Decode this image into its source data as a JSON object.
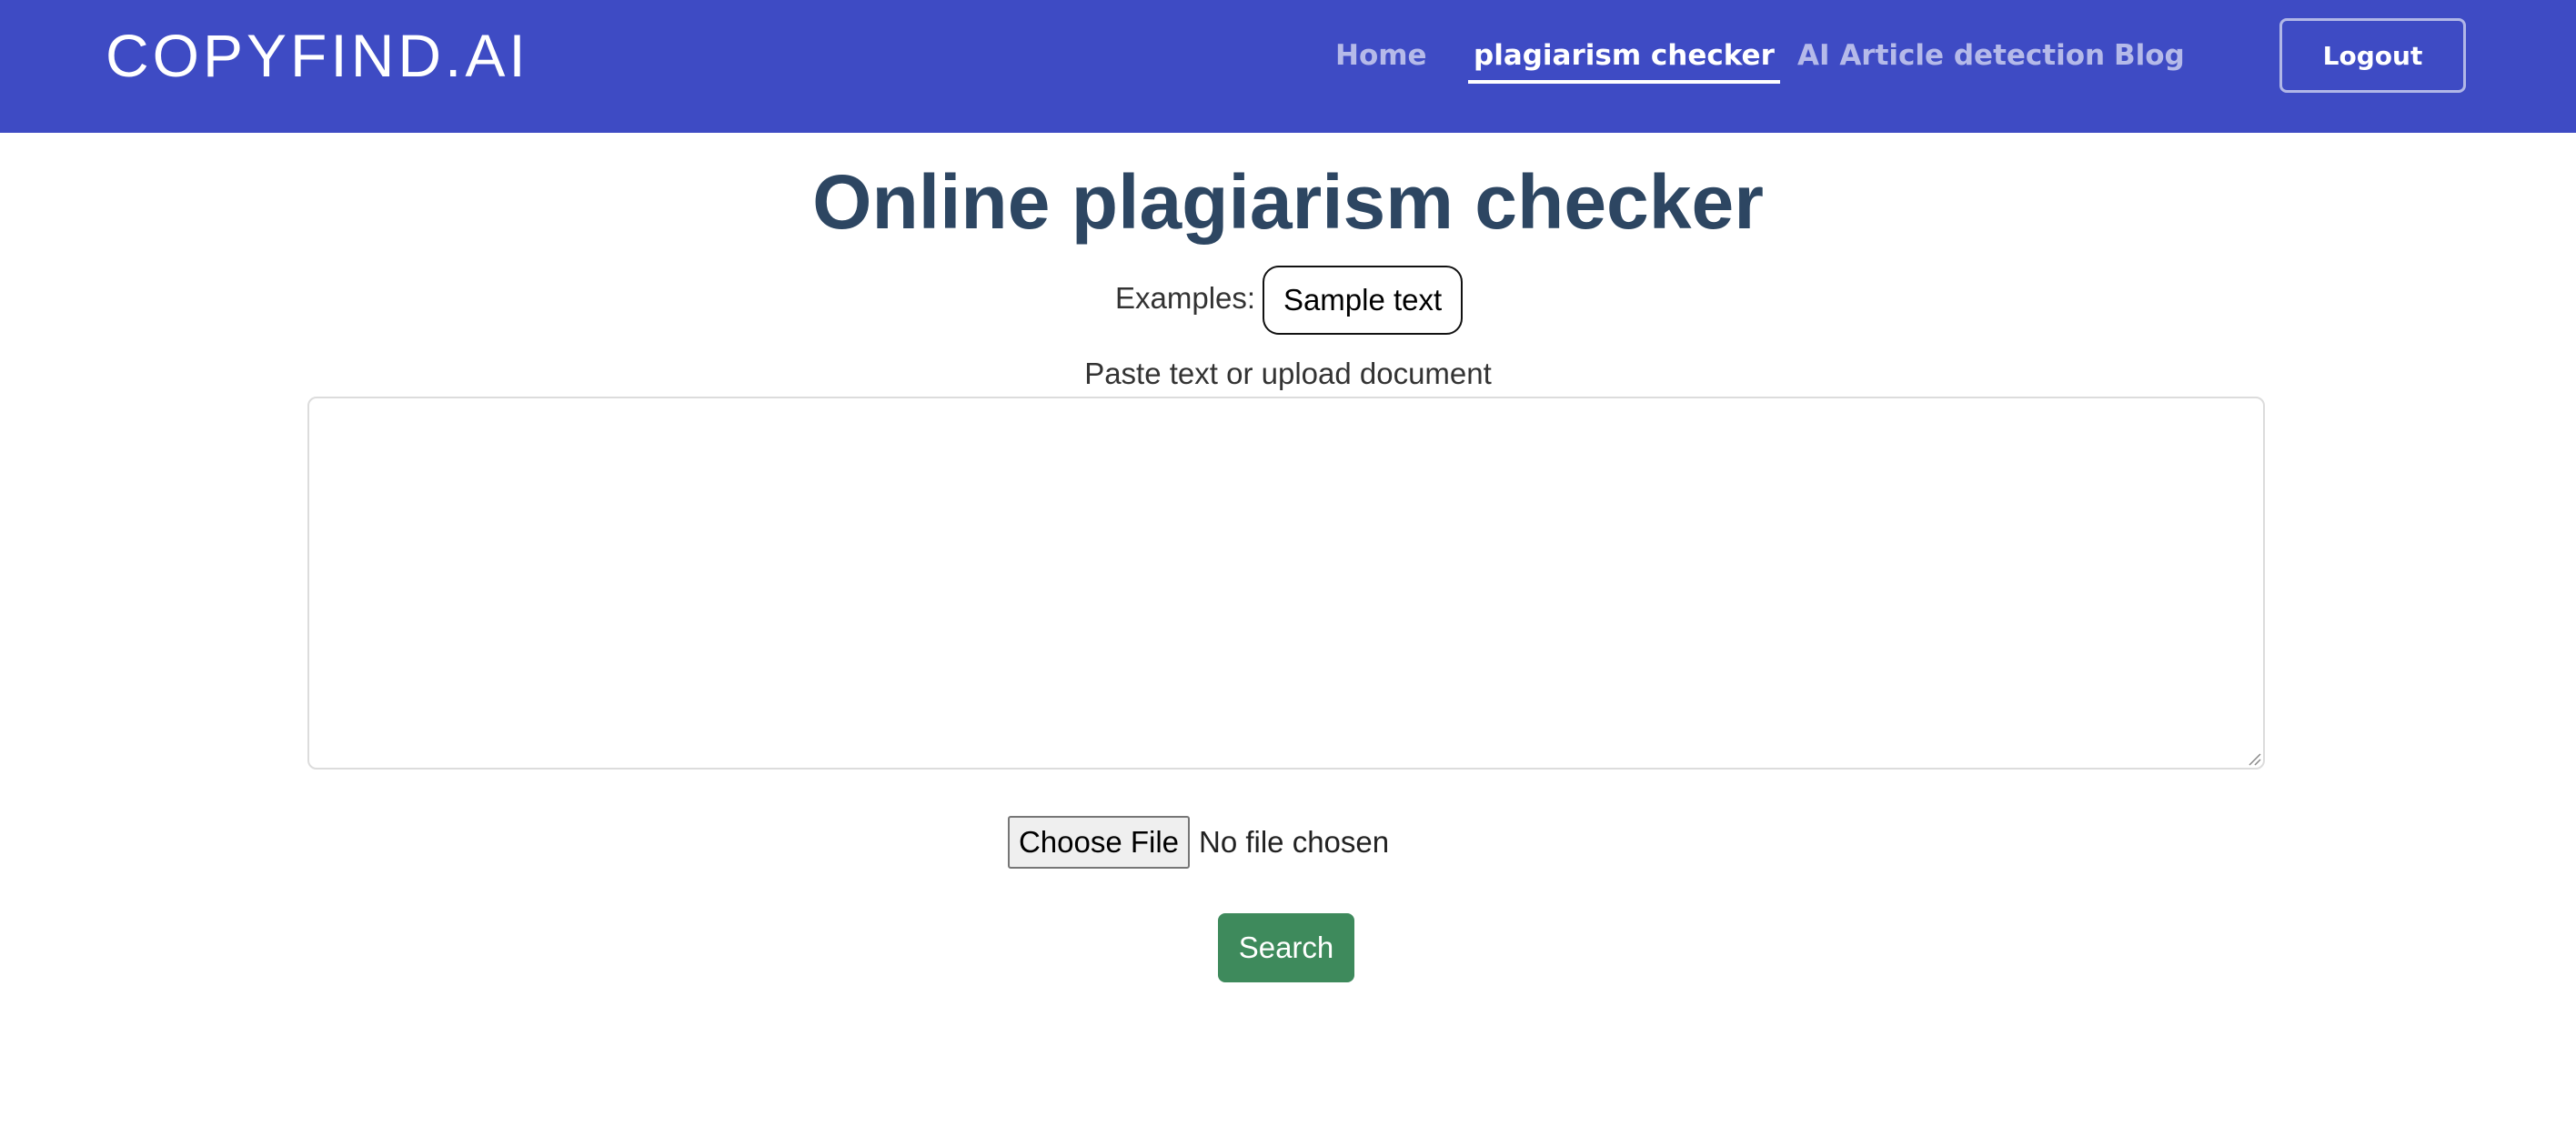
{
  "header": {
    "brand": "COPYFIND.AI",
    "nav": [
      {
        "label": "Home",
        "active": false
      },
      {
        "label": "plagiarism checker",
        "active": true
      },
      {
        "label": "AI Article detection",
        "active": false
      },
      {
        "label": "Blog",
        "active": false
      }
    ],
    "logout_label": "Logout"
  },
  "main": {
    "title": "Online plagiarism checker",
    "examples_label": "Examples:",
    "sample_button_label": "Sample text",
    "textarea_label": "Paste text or upload document",
    "textarea_value": "",
    "file_button_label": "Choose File",
    "file_status": "No file chosen",
    "search_label": "Search"
  },
  "colors": {
    "header_bg": "#3e4bc4",
    "title": "#2d4662",
    "search_button": "#3e8a5c"
  }
}
